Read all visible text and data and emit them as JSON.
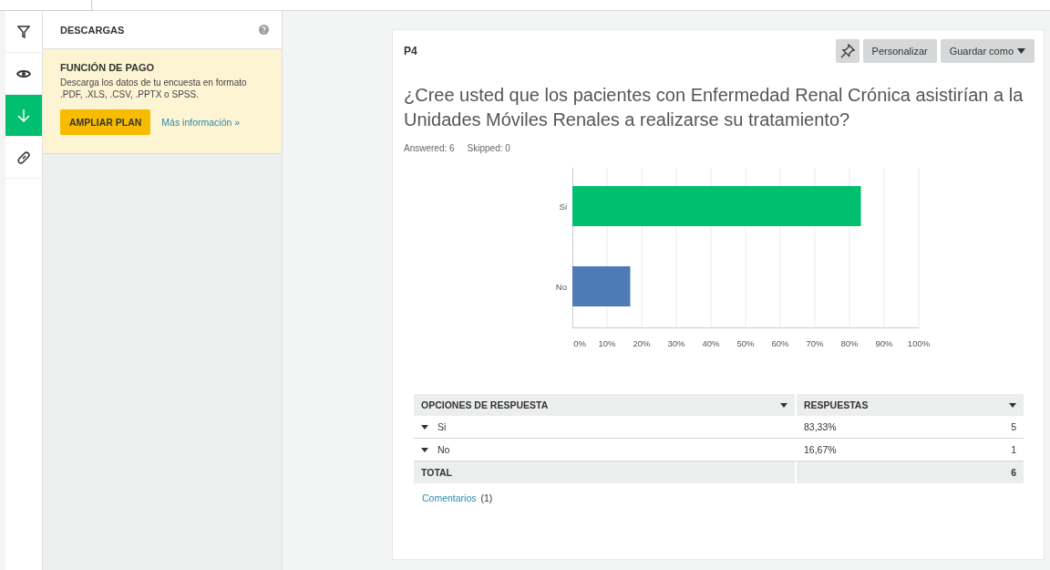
{
  "rail": [
    {
      "selected": false
    },
    {
      "selected": false
    },
    {
      "selected": true
    },
    {
      "selected": false
    }
  ],
  "panel": {
    "title": "DESCARGAS",
    "notice": {
      "title": "FUNCIÓN DE PAGO",
      "text": "Descarga los datos de tu encuesta en formato .PDF, .XLS, .CSV, .PPTX o SPSS.",
      "button": "AMPLIAR PLAN",
      "link": "Más información »"
    }
  },
  "question": {
    "id": "P4",
    "buttons": [
      "Personalizar",
      "Guardar como"
    ],
    "title": "¿Cree usted que los pacientes con Enfermedad Renal Crónica asistirían a la Unidades Móviles Renales a realizarse su tratamiento?",
    "answered": "Answered: 6",
    "skipped": "Skipped: 0",
    "chart_data": {
      "type": "bar",
      "orientation": "horizontal",
      "stacked": true,
      "grid": true,
      "categories": [
        "Si",
        "No"
      ],
      "series": [
        {
          "color": "#00bf6f",
          "values": [
            83.3,
            null
          ]
        },
        {
          "color": "#4e7ab5",
          "values": [
            null,
            16.7
          ]
        }
      ],
      "xlim": [
        0,
        100
      ],
      "xticks": [
        {
          "value": 0,
          "label": "0%"
        },
        {
          "value": 10,
          "label": "10%"
        },
        {
          "value": 20,
          "label": "20%"
        },
        {
          "value": 30,
          "label": "30%"
        },
        {
          "value": 40,
          "label": "40%"
        },
        {
          "value": 50,
          "label": "50%"
        },
        {
          "value": 60,
          "label": "60%"
        },
        {
          "value": 70,
          "label": "70%"
        },
        {
          "value": 80,
          "label": "80%"
        },
        {
          "value": 90,
          "label": "90%"
        },
        {
          "value": 100,
          "label": "100%"
        }
      ]
    },
    "table": {
      "columns": [
        "OPCIONES DE RESPUESTA",
        "RESPUESTAS"
      ],
      "rows": [
        {
          "option": "Si",
          "percent": "83,33%",
          "count": "5"
        },
        {
          "option": "No",
          "percent": "16,67%",
          "count": "1"
        }
      ],
      "total_label": "TOTAL",
      "total": "6"
    },
    "comments": {
      "label": "Comentarios",
      "count": "(1)"
    }
  }
}
